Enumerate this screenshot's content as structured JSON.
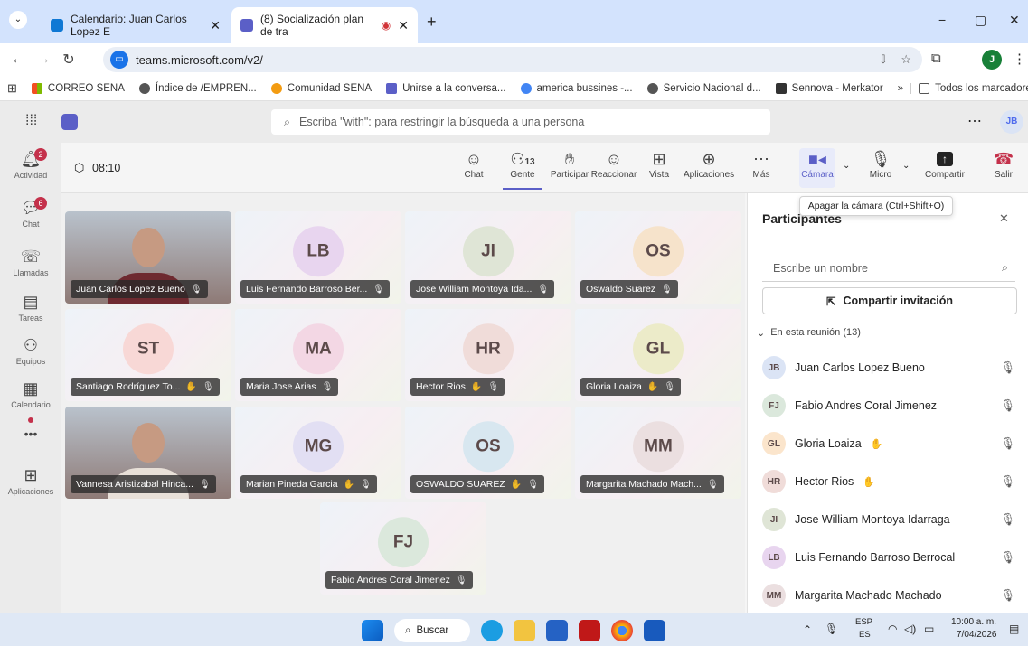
{
  "browser": {
    "tabs": [
      {
        "title": "Calendario: Juan Carlos Lopez E",
        "active": false
      },
      {
        "title": "(8) Socialización plan de tra",
        "active": true
      }
    ],
    "new_tab": "+",
    "url": "teams.microsoft.com/v2/",
    "window_controls": [
      "−",
      "▢",
      "✕"
    ],
    "bookmarks": [
      "CORREO SENA",
      "Índice de /EMPREN...",
      "Comunidad SENA",
      "Unirse a la conversa...",
      "america bussines -...",
      "Servicio Nacional d...",
      "Sennova - Merkator"
    ],
    "bookmarks_more": "»",
    "all_bookmarks": "Todos los marcadores",
    "profile_initial": "J"
  },
  "teams": {
    "search_placeholder": "Escriba \"with\": para restringir la búsqueda a una persona",
    "user_initials": "JB",
    "rail": [
      {
        "label": "Actividad",
        "icon": "bell-icon",
        "badge": "2"
      },
      {
        "label": "Chat",
        "icon": "chat-icon",
        "badge": "6"
      },
      {
        "label": "Llamadas",
        "icon": "phone-icon",
        "badge": ""
      },
      {
        "label": "Tareas",
        "icon": "tasks-icon",
        "badge": ""
      },
      {
        "label": "Equipos",
        "icon": "teams-icon",
        "badge": ""
      },
      {
        "label": "Calendario",
        "icon": "calendar-icon",
        "badge": ""
      },
      {
        "label": "•••",
        "icon": "more-icon",
        "badge": ""
      },
      {
        "label": "Aplicaciones",
        "icon": "apps-icon",
        "badge": ""
      }
    ],
    "meeting": {
      "timer": "08:10",
      "controls": {
        "chat": "Chat",
        "people": "Gente",
        "people_count": "13",
        "raise": "Participar",
        "react": "Reaccionar",
        "view": "Vista",
        "apps": "Aplicaciones",
        "more": "Más",
        "camera": "Cámara",
        "mic": "Micro",
        "share": "Compartir",
        "leave": "Salir"
      },
      "tooltip": "Apagar la cámara (Ctrl+Shift+O)"
    },
    "tiles": [
      {
        "initials": "",
        "name": "Juan Carlos Lopez Bueno",
        "color": "#c4cdd9",
        "video": true,
        "hand": false
      },
      {
        "initials": "LB",
        "name": "Luis Fernando Barroso Ber...",
        "color": "#e8d5ef",
        "video": false,
        "hand": false
      },
      {
        "initials": "JI",
        "name": "Jose William Montoya Ida...",
        "color": "#dfe5d6",
        "video": false,
        "hand": false
      },
      {
        "initials": "OS",
        "name": "Oswaldo Suarez",
        "color": "#f6e3cb",
        "video": false,
        "hand": false
      },
      {
        "initials": "ST",
        "name": "Santiago Rodríguez To...",
        "color": "#f8d8d6",
        "video": false,
        "hand": true
      },
      {
        "initials": "MA",
        "name": "Maria Jose Arias",
        "color": "#f3d7e4",
        "video": false,
        "hand": false
      },
      {
        "initials": "HR",
        "name": "Hector Rios",
        "color": "#f0dcd9",
        "video": false,
        "hand": true
      },
      {
        "initials": "GL",
        "name": "Gloria Loaiza",
        "color": "#ecebc9",
        "video": false,
        "hand": true
      },
      {
        "initials": "",
        "name": "Vannesa Aristizabal Hinca...",
        "color": "#e0e6ee",
        "video": true,
        "hand": false
      },
      {
        "initials": "MG",
        "name": "Marian Pineda Garcia",
        "color": "#e2dff3",
        "video": false,
        "hand": true
      },
      {
        "initials": "OS",
        "name": "OSWALDO SUAREZ",
        "color": "#d8e7f0",
        "video": false,
        "hand": true
      },
      {
        "initials": "MM",
        "name": "Margarita Machado Mach...",
        "color": "#ebdfe0",
        "video": false,
        "hand": false
      },
      {
        "initials": "FJ",
        "name": "Fabio Andres Coral Jimenez",
        "color": "#dbe8dc",
        "video": false,
        "hand": false
      }
    ],
    "panel": {
      "title": "Participantes",
      "close": "✕",
      "search_placeholder": "Escribe un nombre",
      "invite": "Compartir invitación",
      "section": "En esta reunión (13)",
      "participants": [
        {
          "initials": "JB",
          "name": "Juan Carlos Lopez Bueno",
          "color": "#dbe4f5",
          "hand": false
        },
        {
          "initials": "FJ",
          "name": "Fabio Andres Coral Jimenez",
          "color": "#dbe8dc",
          "hand": false
        },
        {
          "initials": "GL",
          "name": "Gloria Loaiza",
          "color": "#fbe5cc",
          "hand": true
        },
        {
          "initials": "HR",
          "name": "Hector Rios",
          "color": "#f0dcd9",
          "hand": true
        },
        {
          "initials": "JI",
          "name": "Jose William Montoya Idarraga",
          "color": "#dfe5d6",
          "hand": false
        },
        {
          "initials": "LB",
          "name": "Luis Fernando Barroso Berrocal",
          "color": "#e8d5ef",
          "hand": false
        },
        {
          "initials": "MM",
          "name": "Margarita Machado Machado",
          "color": "#ebdfe0",
          "hand": false
        }
      ]
    }
  },
  "taskbar": {
    "search": "Buscar",
    "lang_top": "ESP",
    "lang_bottom": "ES",
    "time": "10:00 a. m.",
    "date": "7/04/2026"
  }
}
